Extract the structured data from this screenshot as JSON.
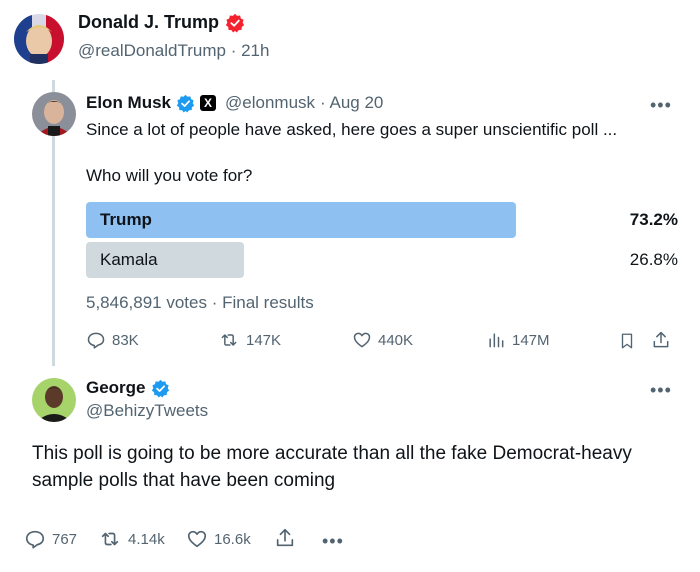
{
  "outer_tweet": {
    "name": "Donald J. Trump",
    "handle": "@realDonaldTrump",
    "time": "· 21h"
  },
  "quoted_tweet": {
    "name": "Elon Musk",
    "handle": "@elonmusk",
    "time": "· Aug 20",
    "text": "Since a lot of people have asked, here goes a super unscientific poll ...",
    "poll": {
      "question": "Who will you vote for?",
      "options": [
        {
          "label": "Trump",
          "percent": "73.2%",
          "fraction": 0.732,
          "winner": true
        },
        {
          "label": "Kamala",
          "percent": "26.8%",
          "fraction": 0.268,
          "winner": false
        }
      ],
      "summary": "5,846,891 votes · Final results"
    },
    "actions": {
      "replies": "83K",
      "reposts": "147K",
      "likes": "440K",
      "views": "147M"
    }
  },
  "reply_tweet": {
    "name": "George",
    "handle": "@BehizyTweets",
    "text": "This poll is going to be more accurate than all the fake Democrat-heavy sample polls that have been coming",
    "actions": {
      "replies": "767",
      "reposts": "4.14k",
      "likes": "16.6k"
    }
  },
  "colors": {
    "verified_blue": "#1d9bf0",
    "trump_badge": "#f4212e",
    "winner_bar": "#8ec0f2",
    "loser_bar": "#cfd9de",
    "muted_text": "#536471"
  }
}
